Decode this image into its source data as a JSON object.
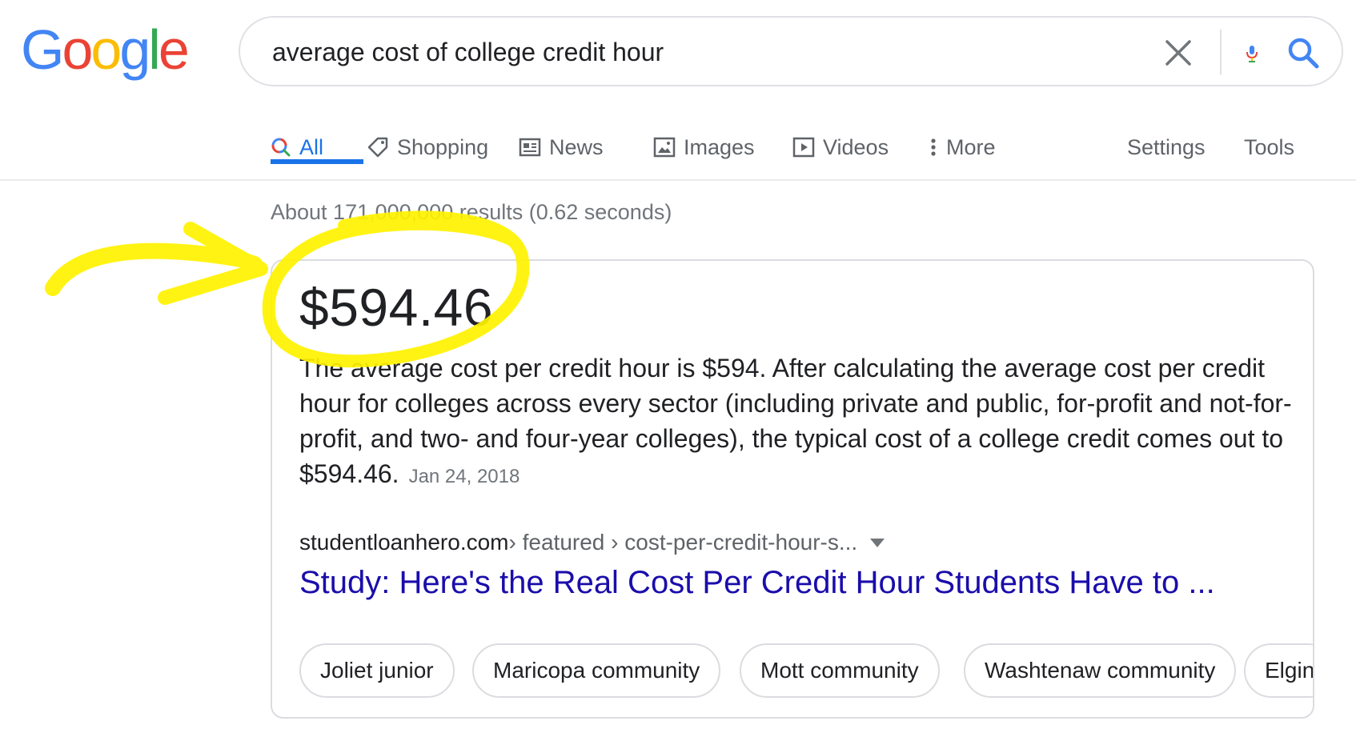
{
  "logo": {
    "text": "Google",
    "letters": [
      "G",
      "o",
      "o",
      "g",
      "l",
      "e"
    ],
    "colors": [
      "#4285F4",
      "#EA4335",
      "#FBBC05",
      "#4285F4",
      "#34A853",
      "#EA4335"
    ]
  },
  "search": {
    "query": "average cost of college credit hour"
  },
  "icons": {
    "clear": "close-icon",
    "voice": "mic-icon",
    "submit": "search-icon"
  },
  "tabs": [
    {
      "label": "All",
      "icon": "search-icon",
      "active": true
    },
    {
      "label": "Shopping",
      "icon": "tag-icon"
    },
    {
      "label": "News",
      "icon": "newspaper-icon"
    },
    {
      "label": "Images",
      "icon": "image-icon"
    },
    {
      "label": "Videos",
      "icon": "play-icon"
    },
    {
      "label": "More",
      "icon": "more-vert-icon"
    }
  ],
  "tools": {
    "settings": "Settings",
    "tools": "Tools"
  },
  "results": {
    "stats": "About 171,000,000 results (0.62 seconds)"
  },
  "snippet": {
    "answer": "$594.46",
    "text": "The average cost per credit hour is $594. After calculating the average cost per credit hour for colleges across every sector (including private and public, for-profit and not-for-profit, and two- and four-year colleges), the typical cost of a college credit comes out to $594.46.",
    "date": "Jan 24, 2018",
    "source_domain": "studentloanhero.com",
    "source_path": " › featured › cost-per-credit-hour-s...",
    "title": "Study: Here's the Real Cost Per Credit Hour Students Have to ..."
  },
  "chips": [
    "Joliet junior",
    "Maricopa community",
    "Mott community",
    "Washtenaw community",
    "Elgin"
  ],
  "annotation": {
    "color": "#FFF200",
    "shape": "hand-drawn arrow and circle around answer"
  }
}
